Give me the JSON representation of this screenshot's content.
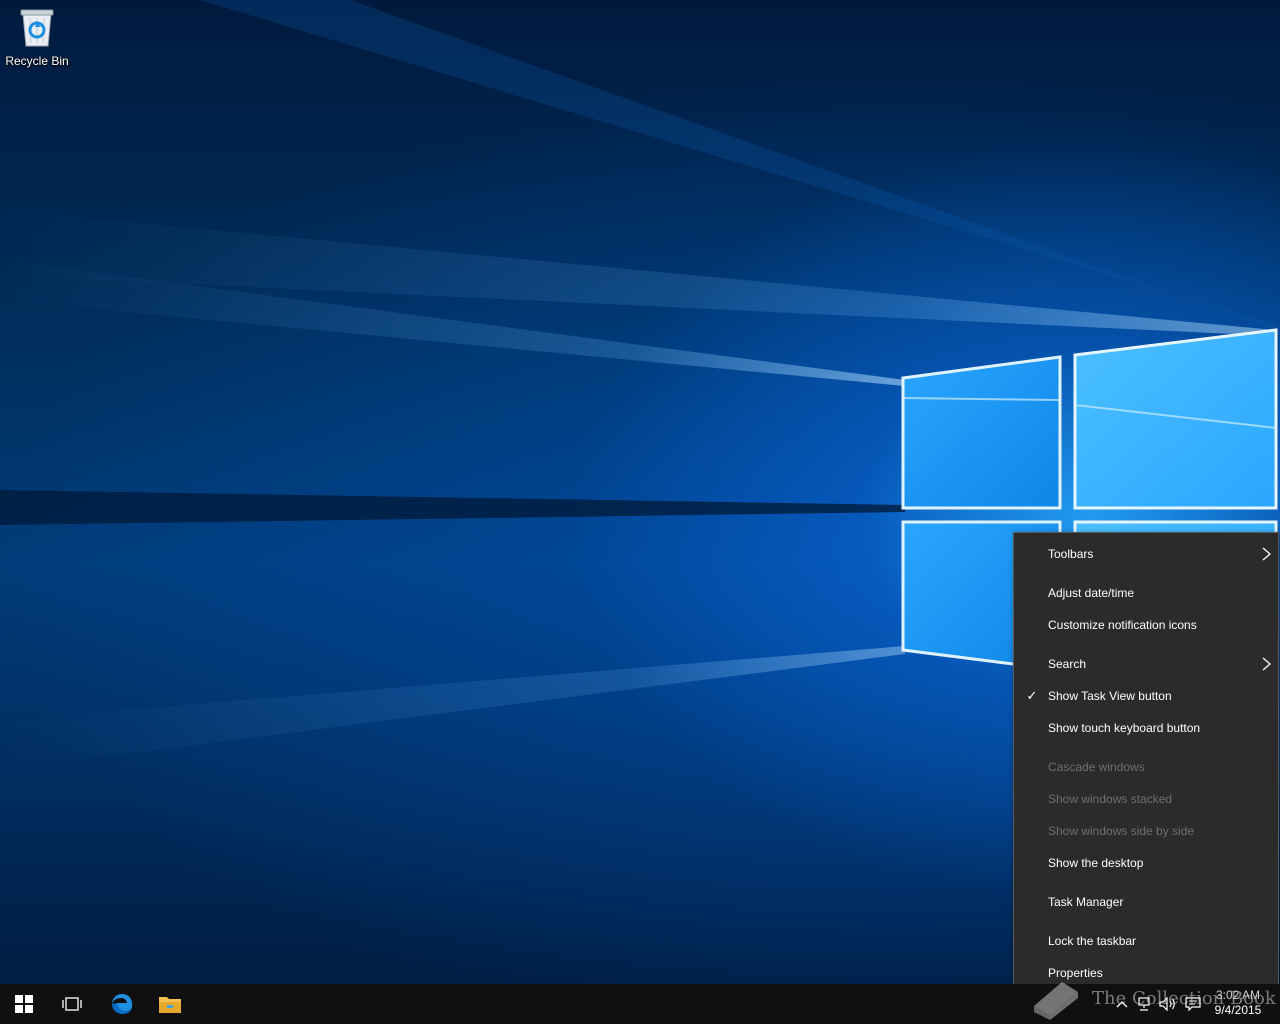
{
  "desktop": {
    "icons": [
      {
        "label": "Recycle Bin",
        "icon": "recycle-bin-icon"
      }
    ]
  },
  "context_menu": {
    "items": [
      {
        "label": "Toolbars",
        "submenu": true,
        "checked": false,
        "disabled": false
      },
      {
        "label": "Adjust date/time",
        "submenu": false,
        "checked": false,
        "disabled": false
      },
      {
        "label": "Customize notification icons",
        "submenu": false,
        "checked": false,
        "disabled": false
      },
      {
        "label": "Search",
        "submenu": true,
        "checked": false,
        "disabled": false
      },
      {
        "label": "Show Task View button",
        "submenu": false,
        "checked": true,
        "disabled": false
      },
      {
        "label": "Show touch keyboard button",
        "submenu": false,
        "checked": false,
        "disabled": false
      },
      {
        "label": "Cascade windows",
        "submenu": false,
        "checked": false,
        "disabled": true
      },
      {
        "label": "Show windows stacked",
        "submenu": false,
        "checked": false,
        "disabled": true
      },
      {
        "label": "Show windows side by side",
        "submenu": false,
        "checked": false,
        "disabled": true
      },
      {
        "label": "Show the desktop",
        "submenu": false,
        "checked": false,
        "disabled": false
      },
      {
        "label": "Task Manager",
        "submenu": false,
        "checked": false,
        "disabled": false
      },
      {
        "label": "Lock the taskbar",
        "submenu": false,
        "checked": false,
        "disabled": false
      },
      {
        "label": "Properties",
        "submenu": false,
        "checked": false,
        "disabled": false
      }
    ],
    "check_glyph": "✓"
  },
  "taskbar": {
    "buttons": [
      {
        "name": "start-button",
        "icon": "windows-logo-icon"
      },
      {
        "name": "task-view-button",
        "icon": "task-view-icon"
      },
      {
        "name": "edge-button",
        "icon": "edge-browser-icon"
      },
      {
        "name": "file-explorer-button",
        "icon": "folder-icon"
      }
    ],
    "tray": {
      "icons": [
        "chevron-up-icon",
        "network-icon",
        "volume-icon",
        "action-center-icon"
      ],
      "time": "3:02 AM",
      "date": "9/4/2015"
    }
  },
  "watermark": {
    "text": "The Collection Book",
    "icon": "book-icon"
  },
  "colors": {
    "menu_bg": "#2b2b2b",
    "menu_border": "#5a5a5a",
    "menu_text": "#ffffff",
    "menu_disabled_text": "#6f6f6f",
    "taskbar_bg": "#101010",
    "accent": "#0a78d7"
  }
}
